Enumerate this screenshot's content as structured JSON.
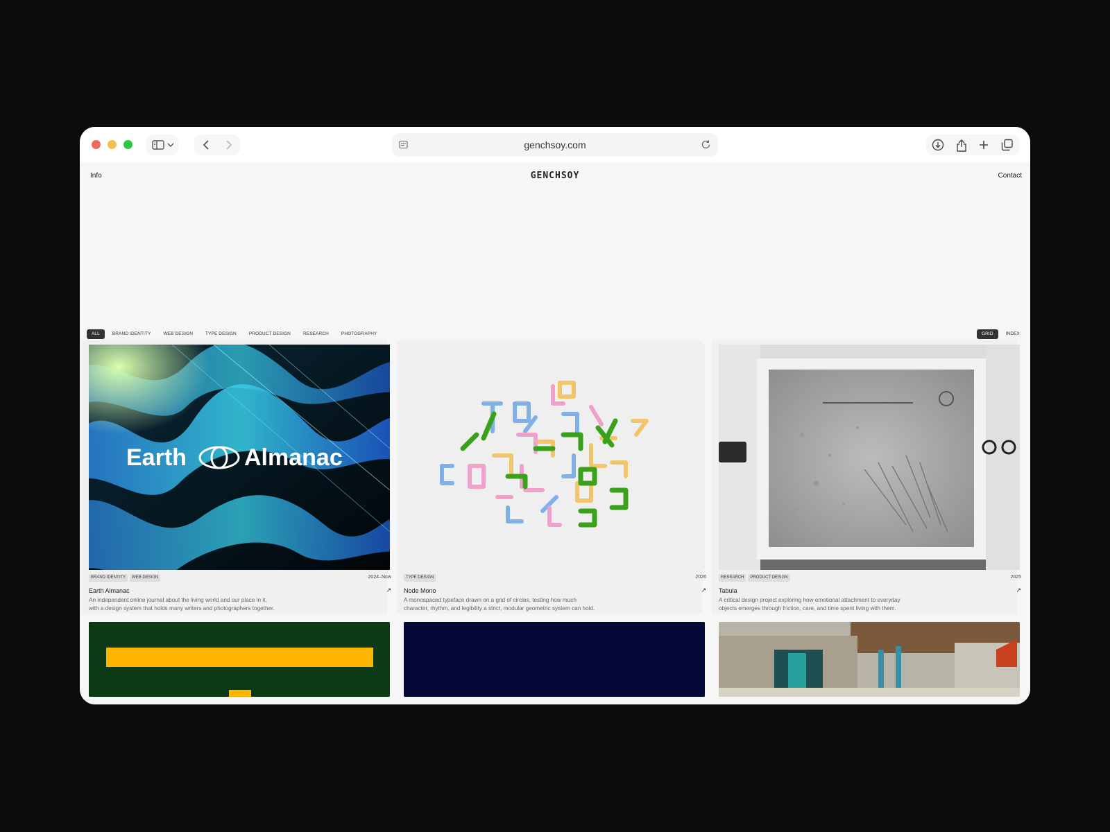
{
  "browser": {
    "url": "genchsoy.com"
  },
  "site": {
    "logo": "GENCHSOY",
    "nav_left": "Info",
    "nav_right": "Contact"
  },
  "filters": [
    "ALL",
    "BRAND IDENTITY",
    "WEB DESIGN",
    "TYPE DESIGN",
    "PRODUCT DESIGN",
    "RESEARCH",
    "PHOTOGRAPHY"
  ],
  "view_toggle": [
    "GRID",
    "INDEX"
  ],
  "projects": [
    {
      "image_text": "Earth Almanac",
      "image_text_left": "Earth",
      "image_text_right": "Almanac",
      "tags": [
        "BRAND IDENTITY",
        "WEB DESIGN"
      ],
      "year": "2024–Now",
      "title": "Earth Almanac",
      "arrow": "↗",
      "desc_line1": "An independent online journal about the living world and our place in it,",
      "desc_line2": "with a design system that holds many writers and photographers together."
    },
    {
      "tags": [
        "TYPE DESIGN"
      ],
      "year": "2026",
      "title": "Node Mono",
      "arrow": "↗",
      "desc_line1": "A monospaced typeface drawn on a grid of circles, testing how much",
      "desc_line2": "character, rhythm, and legibility a strict, modular geometric system can hold."
    },
    {
      "tags": [
        "RESEARCH",
        "PRODUCT DESIGN"
      ],
      "year": "2025",
      "title": "Tabula",
      "arrow": "↗",
      "desc_line1": "A critical design project exploring how emotional attachment to everyday",
      "desc_line2": "objects emerges through friction, care, and time spent living with them."
    }
  ],
  "colors": {
    "backdrop": "#0b0b0b",
    "page": "#f6f6f6",
    "active_chip": "#333333",
    "earth_blue": "#2aa8d8",
    "node_blue": "#7fb0e6",
    "node_pink": "#f0a0cc",
    "node_yellow": "#f3c56a",
    "node_green": "#3aa21a"
  },
  "icons": [
    "sidebar-icon",
    "chevron-down-icon",
    "back-icon",
    "forward-icon",
    "reader-icon",
    "reload-icon",
    "download-icon",
    "share-icon",
    "plus-icon",
    "tabs-icon"
  ]
}
